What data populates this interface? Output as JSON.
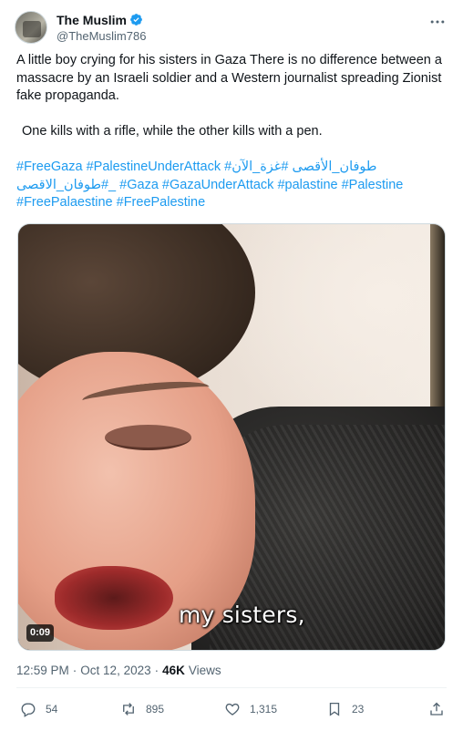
{
  "author": {
    "display_name": "The Muslim",
    "handle": "@TheMuslim786",
    "verified_color": "#1d9bf0"
  },
  "tweet": {
    "text_line1": "A little boy crying for his sisters in Gaza There is no difference between a massacre by an Israeli soldier and a Western journalist spreading Zionist fake propaganda.",
    "text_line2": "One kills with a rifle, while the other kills with a pen.",
    "hashtags": [
      "#FreeGaza",
      "#PalestineUnderAttack",
      "#طوفان_الأقصى",
      "#غزة_الآن",
      "#طوفان_الاقصى_",
      "#Gaza",
      "#GazaUnderAttack",
      "#palastine",
      "#Palestine",
      "#FreePalaestine",
      "#FreePalestine"
    ]
  },
  "media": {
    "caption": "my sisters,",
    "duration": "0:09"
  },
  "meta": {
    "time": "12:59 PM",
    "date": "Oct 12, 2023",
    "views_count": "46K",
    "views_label": "Views"
  },
  "actions": {
    "replies": "54",
    "reposts": "895",
    "likes": "1,315",
    "bookmarks": "23"
  },
  "colors": {
    "link": "#1d9bf0",
    "secondary_text": "#536471",
    "primary_text": "#0f1419"
  }
}
